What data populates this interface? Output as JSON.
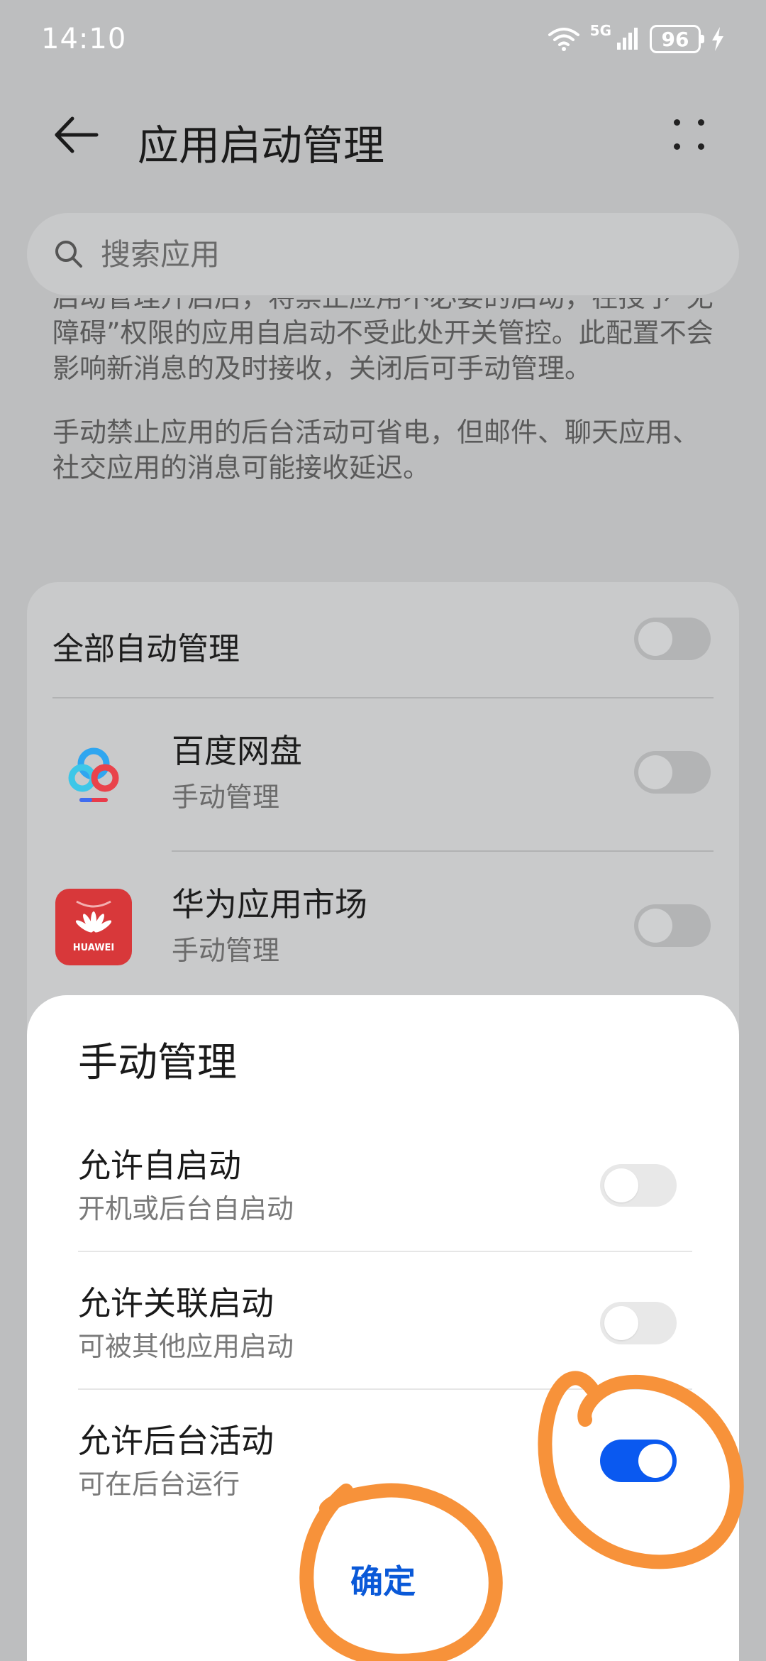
{
  "status_bar": {
    "time": "14:10",
    "network": "5G",
    "battery": "96"
  },
  "header": {
    "title": "应用启动管理"
  },
  "search": {
    "placeholder": "搜索应用"
  },
  "description": {
    "paragraph1": "启动管理开启后，将禁止应用不必要的启动，在授予“无障碍”权限的应用自启动不受此处开关管控。此配置不会影响新消息的及时接收，关闭后可手动管理。",
    "paragraph2": "手动禁止应用的后台活动可省电，但邮件、聊天应用、社交应用的消息可能接收延迟。"
  },
  "app_list": {
    "all_label": "全部自动管理",
    "all_toggle_on": false,
    "apps": [
      {
        "name": "百度网盘",
        "status": "手动管理",
        "icon": "baidu-netdisk-icon",
        "toggle_on": false
      },
      {
        "name": "华为应用市场",
        "status": "手动管理",
        "icon": "huawei-appgallery-icon",
        "icon_text": "HUAWEI",
        "toggle_on": false
      }
    ]
  },
  "sheet": {
    "title": "手动管理",
    "options": [
      {
        "title": "允许自启动",
        "subtitle": "开机或后台自启动",
        "on": false
      },
      {
        "title": "允许关联启动",
        "subtitle": "可被其他应用启动",
        "on": false
      },
      {
        "title": "允许后台活动",
        "subtitle": "可在后台运行",
        "on": true
      }
    ],
    "confirm_label": "确定"
  },
  "colors": {
    "accent": "#0a59f0",
    "annotation": "#f7923a",
    "dim_background": "#bdbebf"
  }
}
